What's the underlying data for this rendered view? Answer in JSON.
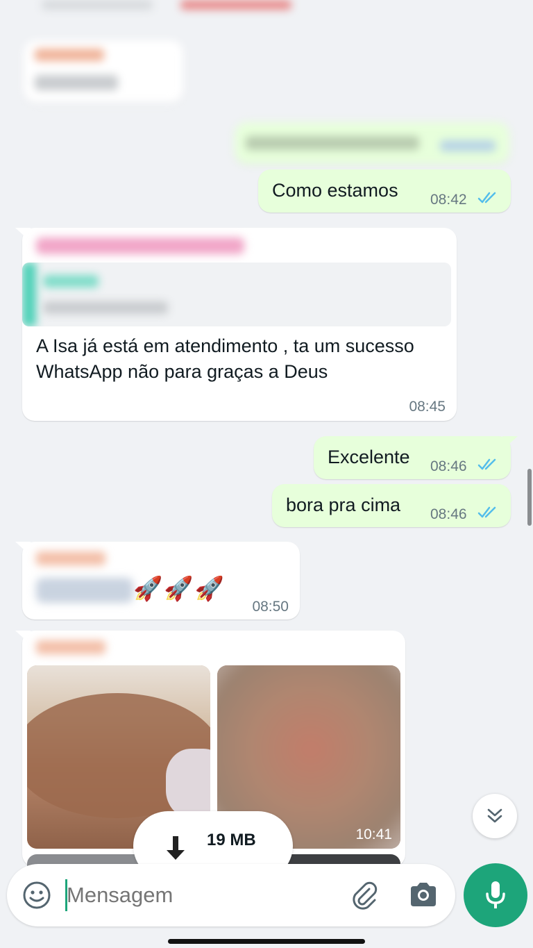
{
  "messages": {
    "m1": {
      "text": "Como estamos",
      "time": "08:42"
    },
    "m2": {
      "text": "A Isa já está em atendimento , ta um sucesso  WhatsApp não para graças a Deus",
      "time": "08:45"
    },
    "m3": {
      "text": "Excelente",
      "time": "08:46"
    },
    "m4": {
      "text": "bora pra cima",
      "time": "08:46"
    },
    "m5": {
      "emoji": "🚀🚀🚀",
      "time": "08:50"
    },
    "m6": {
      "time": "10:41",
      "download_size": "19 MB"
    }
  },
  "input": {
    "placeholder": "Mensagem"
  },
  "icons": {
    "emoji": "emoji-icon",
    "attach": "paperclip-icon",
    "camera": "camera-icon",
    "mic": "mic-icon",
    "scroll": "chevron-double-down-icon",
    "download": "download-icon",
    "read_ticks": "double-check-icon"
  },
  "colors": {
    "background": "#f0f2f5",
    "outgoing_bubble": "#e7ffdb",
    "incoming_bubble": "#ffffff",
    "read_ticks": "#53bdeb",
    "mic_button": "#1da57a",
    "cursor": "#1da57a"
  }
}
